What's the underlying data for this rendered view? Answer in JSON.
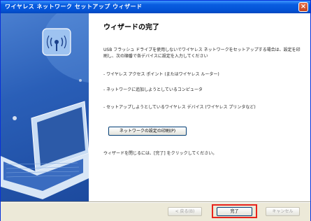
{
  "window": {
    "title": "ワイヤレス ネットワーク セットアップ ウィザード",
    "close_glyph": "×"
  },
  "main": {
    "heading": "ウィザードの完了",
    "paragraph": "USB フラッシュ ドライブを使用しないでワイヤレス ネットワークをセットアップする場合は、設定を印刷し、次の順番で各デバイスに設定を入力してください",
    "items": [
      "- ワイヤレス アクセス ポイント (またはワイヤレス ルーター)",
      "- ネットワークに追加しようとしているコンピュータ",
      "- セットアップしようとしているワイヤレス デバイス (ワイヤレス プリンタなど)"
    ],
    "print_button": "ネットワークの設定の印刷(P)",
    "closing_text": "ウィザードを閉じるには、[完了] をクリックしてください。"
  },
  "footer": {
    "back": "< 戻る(B)",
    "finish": "完了",
    "cancel": "キャンセル"
  },
  "colors": {
    "title_bar": "#0454d8",
    "highlight": "#e8231c",
    "left_panel": "#2a5fb8"
  },
  "icons": [
    "wireless-antenna-icon",
    "laptop-illustration",
    "close-icon"
  ]
}
